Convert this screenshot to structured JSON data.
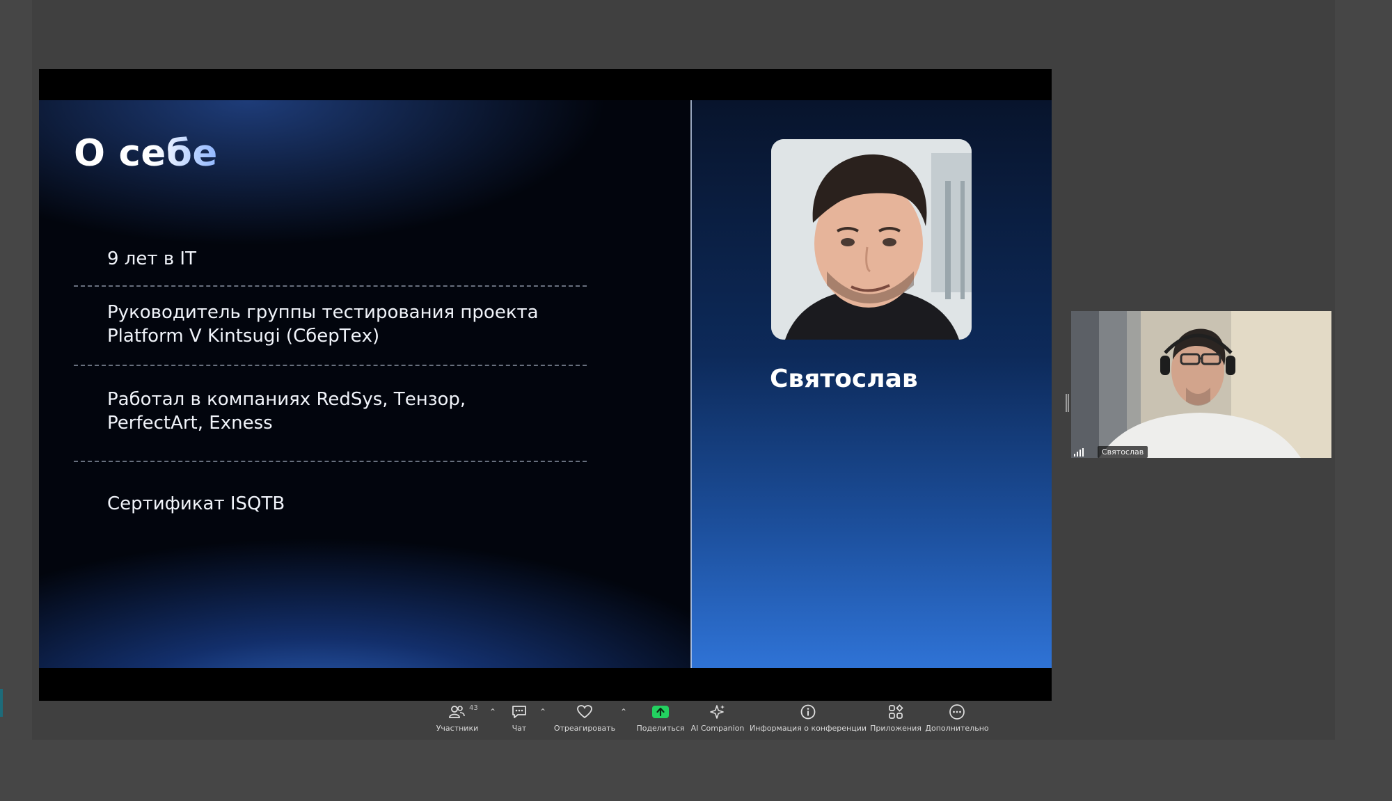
{
  "slide": {
    "title": "О себе",
    "facts": [
      {
        "lines": [
          "9 лет в IT"
        ]
      },
      {
        "lines": [
          "Руководитель группы тестирования проекта",
          "Platform V Kintsugi (СберТех)"
        ]
      },
      {
        "lines": [
          "Работал в компаниях RedSys, Тензор,",
          "PerfectArt, Exness"
        ]
      },
      {
        "lines": [
          "Сертификат ISQTB"
        ]
      }
    ],
    "presenter_name": "Святослав"
  },
  "video_tile": {
    "participant_name": "Святослав"
  },
  "toolbar": {
    "participants_label": "Участники",
    "participants_count": "43",
    "chat_label": "Чат",
    "react_label": "Отреагировать",
    "share_label": "Поделиться",
    "ai_label": "AI Companion",
    "info_label": "Информация о конференции",
    "apps_label": "Приложения",
    "more_label": "Дополнительно"
  },
  "colors": {
    "app_background": "#464646",
    "share_accent": "#23d160",
    "slide_accent_blue": "#2f73d6"
  },
  "icons": [
    "participants-icon",
    "chat-icon",
    "heart-icon",
    "share-arrow-icon",
    "sparkle-icon",
    "info-icon",
    "apps-icon",
    "more-icon",
    "signal-icon"
  ]
}
